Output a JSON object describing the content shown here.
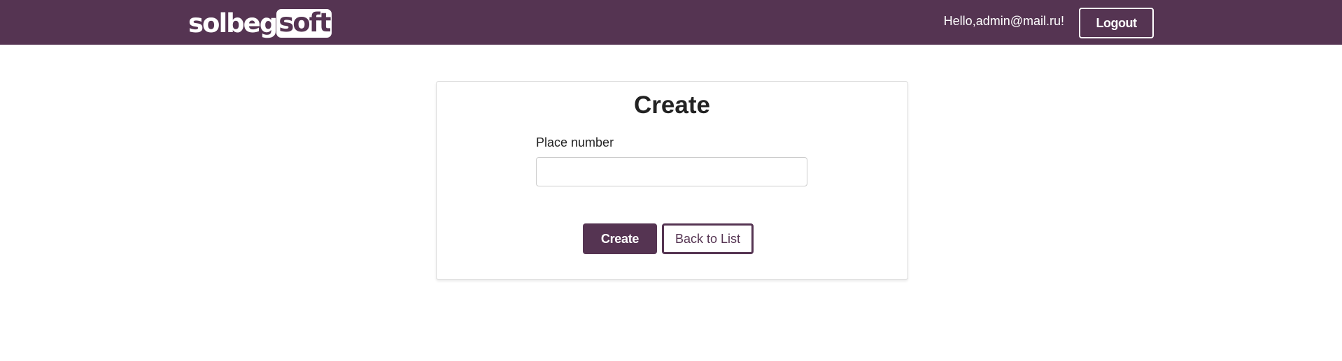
{
  "header": {
    "logo_part1": "solbeg",
    "logo_part2": "soft",
    "greeting": "Hello,admin@mail.ru!",
    "logout_label": "Logout"
  },
  "form": {
    "title": "Create",
    "place_number_label": "Place number",
    "place_number_value": "",
    "create_label": "Create",
    "back_label": "Back to List"
  },
  "colors": {
    "brand": "#553452",
    "header_text": "#ffffff"
  }
}
